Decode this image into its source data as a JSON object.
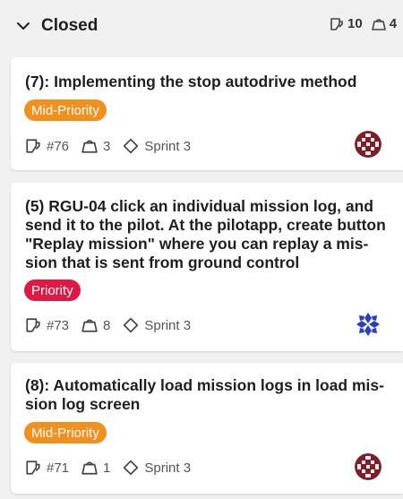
{
  "column": {
    "title": "Closed",
    "issue_count": "10",
    "weight_count": "4"
  },
  "colors": {
    "mid_priority": "#f0901e",
    "priority": "#dd1a45",
    "card_bg": "#ffffff",
    "page_bg": "#f0f0f0"
  },
  "icons": {
    "collapse": "chevron-down-icon",
    "issues": "issue-icon",
    "weight": "weight-icon",
    "sprint": "sprint-diamond-icon"
  },
  "cards": [
    {
      "title": "(7): Implementing the stop autodrive method",
      "label": "Mid-Priority",
      "issue_number": "#76",
      "weight": "3",
      "sprint": "Sprint 3",
      "assignee_avatar": "avatar-maroon-pattern"
    },
    {
      "title": "(5) RGU-04 click an individual mission log, and send it to the pilot. At the pilotapp, create button \"Replay mission\" where you can replay a mis- sion that is sent from ground control",
      "title_lines": [
        "(5) RGU-04 click an individual mission log, and",
        "send it to the pilot. At the pilotapp, create button",
        "\"Replay mission\" where you can replay a mis-",
        "sion that is sent from ground control"
      ],
      "label": "Priority",
      "issue_number": "#73",
      "weight": "8",
      "sprint": "Sprint 3",
      "assignee_avatar": "avatar-blue-pattern"
    },
    {
      "title": "(8): Automatically load mission logs in load mis- sion log screen",
      "title_lines": [
        "(8): Automatically load mission logs in load mis-",
        "sion log screen"
      ],
      "label": "Mid-Priority",
      "issue_number": "#71",
      "weight": "1",
      "sprint": "Sprint 3",
      "assignee_avatar": "avatar-maroon-pattern"
    }
  ]
}
